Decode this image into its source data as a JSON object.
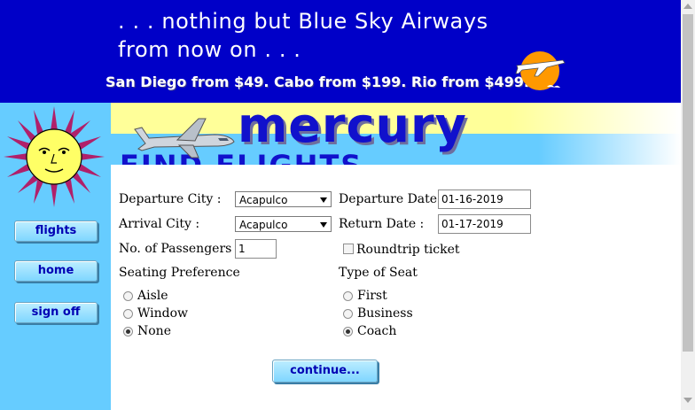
{
  "banner": {
    "tagline_line1": ". . . nothing but Blue Sky Airways",
    "tagline_line2": "from now on . . .",
    "deals": "San Diego from $49. Cabo from $199. Rio from $499."
  },
  "header": {
    "brand": "mercury",
    "page_heading": "FIND FLIGHTS"
  },
  "nav": {
    "flights": "flights",
    "home": "home",
    "signoff": "sign off"
  },
  "form": {
    "departure_city_label": "Departure City :",
    "departure_city_value": "Acapulco",
    "arrival_city_label": "Arrival City :",
    "arrival_city_value": "Acapulco",
    "passengers_label": "No. of Passengers :",
    "passengers_value": "1",
    "departure_date_label": "Departure Date :",
    "departure_date_value": "01-16-2019",
    "return_date_label": "Return Date :",
    "return_date_value": "01-17-2019",
    "roundtrip_label": "Roundtrip ticket",
    "roundtrip_checked": false,
    "seating_pref_label": "Seating Preference",
    "seating_options": [
      "Aisle",
      "Window",
      "None"
    ],
    "seating_selected": "None",
    "seat_type_label": "Type of Seat",
    "seat_type_options": [
      "First",
      "Business",
      "Coach"
    ],
    "seat_type_selected": "Coach",
    "continue_label": "continue..."
  },
  "colors": {
    "banner_bg": "#0000c8",
    "nav_bg": "#66ccff",
    "header_yellow": "#ffff99",
    "brand_blue": "#1111cc"
  },
  "icons": [
    "airplane-sun-icon",
    "sun-face-icon",
    "airplane-icon",
    "dropdown-caret-icon"
  ]
}
